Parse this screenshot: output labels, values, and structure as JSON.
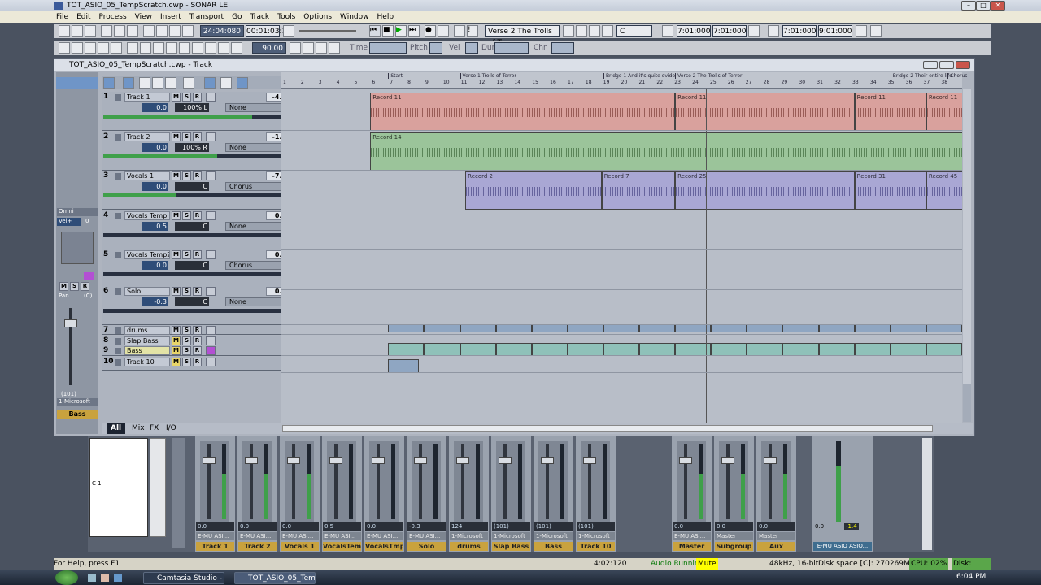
{
  "window": {
    "title": "TOT_ASIO_05_TempScratch.cwp - SONAR LE"
  },
  "menu": [
    "File",
    "Edit",
    "Process",
    "View",
    "Insert",
    "Transport",
    "Go",
    "Track",
    "Tools",
    "Options",
    "Window",
    "Help"
  ],
  "toolbar": {
    "now_time": "24:04:080",
    "time2": "00:01:03:12",
    "marker_select": "Verse 2 The Trolls of Te",
    "key": "C",
    "loop_start": "7:01:000",
    "loop_end": "7:01:000",
    "punch_start": "7:01:000",
    "punch_end": "9:01:000",
    "tempo": "90.00",
    "field_time": "Time",
    "field_pitch": "Pitch",
    "field_vel": "Vel",
    "field_dur": "Dur",
    "field_chn": "Chn"
  },
  "track_view": {
    "title": "TOT_ASIO_05_TempScratch.cwp - Track",
    "tabs": [
      "All",
      "Mix",
      "FX",
      "I/O"
    ],
    "inspector": {
      "omni": "Omni",
      "vel": "Vel+",
      "vel_val": "0",
      "pan": "Pan",
      "pan_val": "(C)",
      "vol": "(101)",
      "out": "1-Microsoft",
      "name": "Bass"
    },
    "tracks": [
      {
        "num": "1",
        "name": "Track 1",
        "vol": "-4.8",
        "v2": "0.0",
        "pan": "100% L",
        "fx": "None"
      },
      {
        "num": "2",
        "name": "Track 2",
        "vol": "-1.5",
        "v2": "0.0",
        "pan": "100% R",
        "fx": "None"
      },
      {
        "num": "3",
        "name": "Vocals 1",
        "vol": "-7.7",
        "v2": "0.0",
        "pan": "C",
        "fx": "Chorus"
      },
      {
        "num": "4",
        "name": "Vocals Temp",
        "vol": "0.0",
        "v2": "0.5",
        "pan": "C",
        "fx": "None"
      },
      {
        "num": "5",
        "name": "Vocals Temp2",
        "vol": "0.0",
        "v2": "0.0",
        "pan": "C",
        "fx": "Chorus"
      },
      {
        "num": "6",
        "name": "Solo",
        "vol": "0.0",
        "v2": "-0.3",
        "pan": "C",
        "fx": "None"
      },
      {
        "num": "7",
        "name": "drums"
      },
      {
        "num": "8",
        "name": "Slap Bass"
      },
      {
        "num": "9",
        "name": "Bass"
      },
      {
        "num": "10",
        "name": "Track 10"
      }
    ],
    "ruler": {
      "numbers": [
        "1",
        "2",
        "3",
        "4",
        "5",
        "6",
        "7",
        "8",
        "9",
        "10",
        "11",
        "12",
        "13",
        "14",
        "15",
        "16",
        "17",
        "18",
        "19",
        "20",
        "21",
        "22",
        "23",
        "24",
        "25",
        "26",
        "27",
        "28",
        "29",
        "30",
        "31",
        "32",
        "33",
        "34",
        "35",
        "36",
        "37",
        "38"
      ],
      "sections": [
        "Start",
        "Verse 1 Trolls of Terror",
        "Bridge 1 And it's quite evide",
        "Verse 2 The Trolls of Terror",
        "Bridge 2 Their entire life",
        "Chorus"
      ]
    },
    "clips": {
      "t1": [
        "Record 11",
        "Record 11",
        "Record 11",
        "Record 11"
      ],
      "t2": [
        "Record 14"
      ],
      "t3": [
        "Record 2",
        "Record 7",
        "Record 25",
        "Record 31",
        "Record 45"
      ]
    }
  },
  "console": {
    "strips": [
      {
        "name": "Track 1",
        "val": "0.0",
        "val2": "-4.8",
        "out": "E-MU ASI..."
      },
      {
        "name": "Track 2",
        "val": "0.0",
        "val2": "-1.5",
        "out": "E-MU ASI..."
      },
      {
        "name": "Vocals 1",
        "val": "0.0",
        "val2": "-7.7",
        "out": "E-MU ASI..."
      },
      {
        "name": "VocalsTemp",
        "val": "0.5",
        "val2": "",
        "out": "E-MU ASI..."
      },
      {
        "name": "VocalsTmp2",
        "val": "0.0",
        "val2": "",
        "out": "E-MU ASI..."
      },
      {
        "name": "Solo",
        "val": "-0.3",
        "val2": "",
        "out": "E-MU ASI..."
      },
      {
        "name": "drums",
        "val": "124",
        "val2": "",
        "out": "1-Microsoft"
      },
      {
        "name": "Slap Bass",
        "val": "(101)",
        "val2": "",
        "out": "1-Microsoft"
      },
      {
        "name": "Bass",
        "val": "(101)",
        "val2": "",
        "out": "1-Microsoft"
      },
      {
        "name": "Track 10",
        "val": "(101)",
        "val2": "",
        "out": "1-Microsoft"
      }
    ],
    "buses": [
      {
        "name": "Master",
        "val": "0.0",
        "out": "E-MU ASI..."
      },
      {
        "name": "Subgroup",
        "val": "0.0",
        "out": "Master"
      },
      {
        "name": "Aux",
        "val": "0.0",
        "out": "Master"
      }
    ],
    "main": {
      "name": "E-MU ASIO ASIO...",
      "val": "0.0",
      "val2": "-1.4"
    },
    "piano_label": "C 1"
  },
  "status": {
    "help": "For Help, press F1",
    "time": "4:02:120",
    "audio": "Audio Runnin",
    "mute": "Mute",
    "format": "48kHz, 16-bit",
    "disk": "Disk space [C]: 270269MB (56'",
    "cpu": "CPU: 02%",
    "disk2": "Disk: 07%"
  },
  "taskbar": {
    "items": [
      "Camtasia Studio - U...",
      "TOT_ASIO_05_TempScr..."
    ],
    "clock": "6:04 PM"
  }
}
